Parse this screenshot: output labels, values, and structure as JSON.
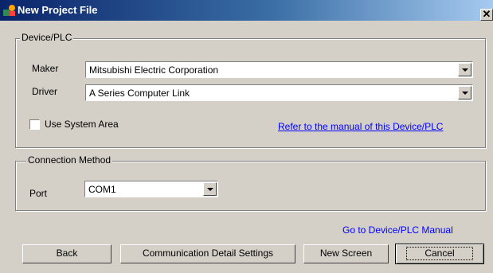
{
  "window": {
    "title": "New Project File",
    "close_glyph": "✕",
    "app_icon": "project-icon"
  },
  "device_group": {
    "label": "Device/PLC",
    "maker_label": "Maker",
    "maker_value": "Mitsubishi Electric Corporation",
    "driver_label": "Driver",
    "driver_value": "A Series Computer Link",
    "use_system_area_label": "Use System Area",
    "use_system_area_checked": false,
    "manual_link": "Refer to the manual of this Device/PLC"
  },
  "connection_group": {
    "label": "Connection Method",
    "port_label": "Port",
    "port_value": "COM1"
  },
  "footer": {
    "manual_link": "Go to Device/PLC Manual",
    "back_button": "Back",
    "comm_button": "Communication Detail Settings",
    "new_screen_button": "New Screen",
    "cancel_button": "Cancel"
  },
  "colors": {
    "face": "#d4d0c8",
    "title_start": "#0a246a",
    "title_end": "#a6caf0",
    "link": "#0000ff"
  }
}
